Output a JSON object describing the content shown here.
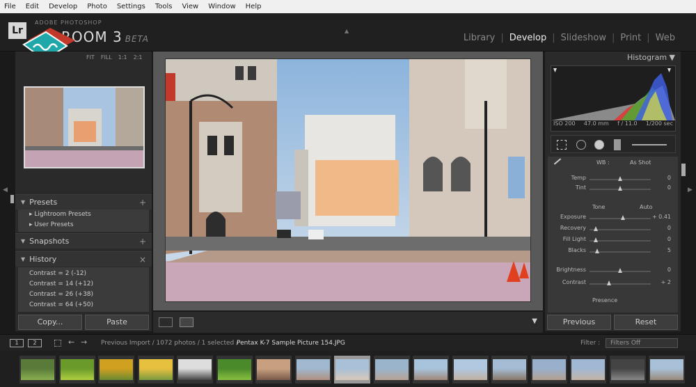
{
  "menu": [
    "File",
    "Edit",
    "Develop",
    "Photo",
    "Settings",
    "Tools",
    "View",
    "Window",
    "Help"
  ],
  "identity": {
    "logo": "Lr",
    "brand_line": "ADOBE PHOTOSHOP",
    "product": "LIGHTROOM 3",
    "beta": "BETA",
    "product_visible": "ROOM 3"
  },
  "modules": [
    "Library",
    "Develop",
    "Slideshow",
    "Print",
    "Web"
  ],
  "active_module": "Develop",
  "navigator": {
    "zoom_options": [
      "FIT",
      "FILL",
      "1:1",
      "2:1"
    ]
  },
  "presets": {
    "title": "Presets",
    "items": [
      "Lightroom Presets",
      "User Presets"
    ]
  },
  "snapshots": {
    "title": "Snapshots"
  },
  "history": {
    "title": "History",
    "items": [
      "Contrast = 2 (-12)",
      "Contrast = 14 (+12)",
      "Contrast = 26 (+38)",
      "Contrast = 64 (+50)"
    ]
  },
  "left_buttons": {
    "copy": "Copy...",
    "paste": "Paste"
  },
  "histogram": {
    "title": "Histogram",
    "iso": "ISO 200",
    "focal": "47.0 mm",
    "aperture": "f / 11.0",
    "shutter": "1/200 sec"
  },
  "basic": {
    "wb_label": "WB :",
    "wb_value": "As Shot",
    "tone_label": "Tone",
    "auto_label": "Auto",
    "presence_label": "Presence",
    "sliders": [
      {
        "label": "Temp",
        "value": "0",
        "pos": 0.5
      },
      {
        "label": "Tint",
        "value": "0",
        "pos": 0.5
      },
      {
        "label": "Exposure",
        "value": "+ 0.41",
        "pos": 0.55
      },
      {
        "label": "Recovery",
        "value": "0",
        "pos": 0.1
      },
      {
        "label": "Fill Light",
        "value": "0",
        "pos": 0.1
      },
      {
        "label": "Blacks",
        "value": "5",
        "pos": 0.12
      },
      {
        "label": "Brightness",
        "value": "0",
        "pos": 0.5
      },
      {
        "label": "Contrast",
        "value": "+ 2",
        "pos": 0.32
      }
    ]
  },
  "right_buttons": {
    "previous": "Previous",
    "reset": "Reset"
  },
  "filmbar": {
    "monitor1": "1",
    "monitor2": "2",
    "source": "Previous Import / 1072 photos / 1 selected /",
    "filename": "Pentax K-7 Sample Picture 154.JPG",
    "filter_label": "Filter :",
    "filter_value": "Filters Off"
  },
  "colors": {
    "active_module": "#eeeeee",
    "panel": "#2a2a2a",
    "center_bg": "#595959",
    "accent_teal": "#1fa7a9",
    "accent_red": "#c0392b"
  },
  "icons": [
    "crop-icon",
    "spot-removal-icon",
    "red-eye-icon",
    "graduated-filter-icon",
    "adjustment-brush-icon",
    "eyedropper-icon",
    "grid-view-icon",
    "before-after-icon"
  ]
}
